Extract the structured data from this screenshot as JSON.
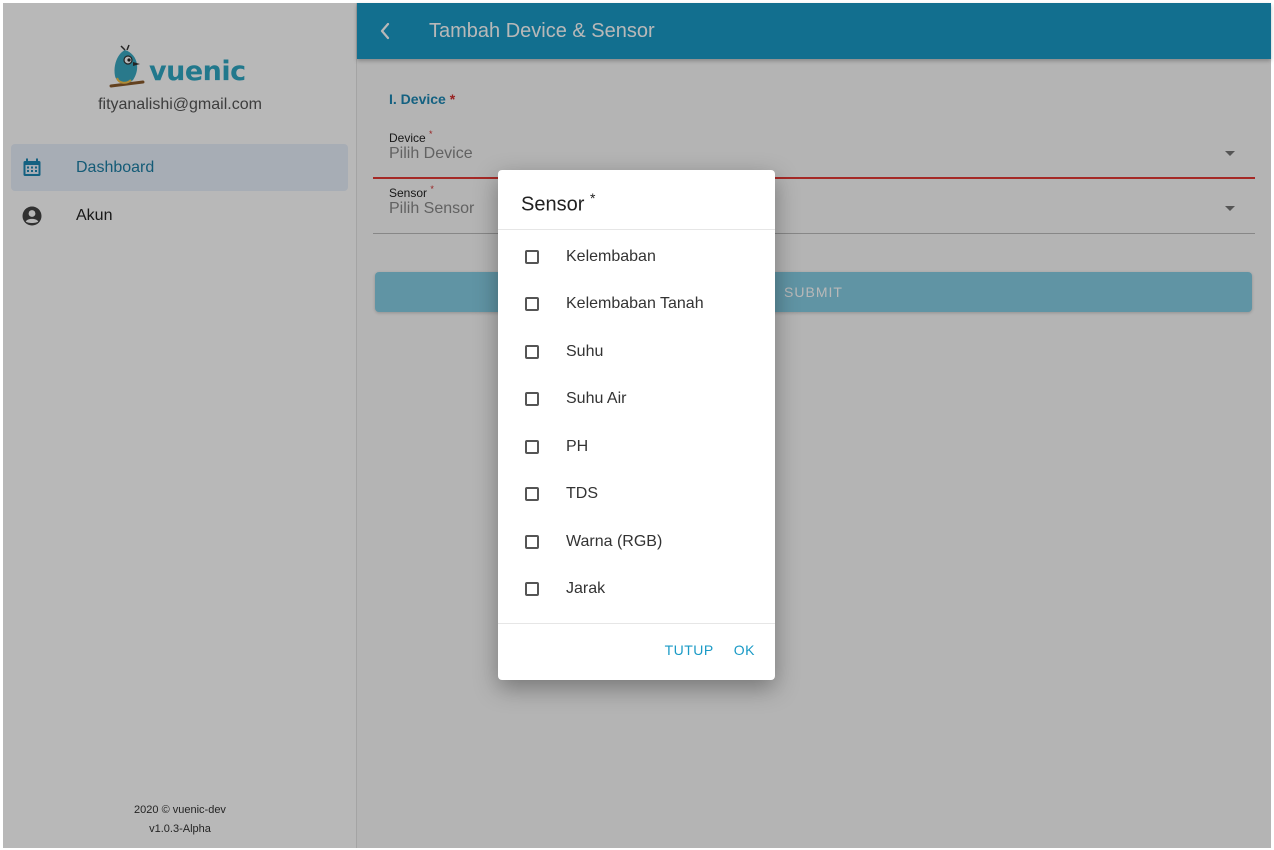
{
  "app": {
    "brand": "vuenic",
    "user_email": "fityanalishi@gmail.com"
  },
  "sidebar": {
    "items": [
      {
        "label": "Dashboard",
        "icon": "calendar-icon",
        "active": true
      },
      {
        "label": "Akun",
        "icon": "account-circle-icon",
        "active": false
      }
    ],
    "footer_line1": "2020 © vuenic-dev",
    "footer_line2": "v1.0.3-Alpha"
  },
  "header": {
    "title": "Tambah Device & Sensor",
    "back_icon": "chevron-left-icon"
  },
  "form": {
    "section_label": "I. Device",
    "required_mark": "*",
    "device": {
      "label": "Device",
      "placeholder": "Pilih Device"
    },
    "sensor": {
      "label": "Sensor",
      "placeholder": "Pilih Sensor"
    },
    "submit_label": "SUBMIT"
  },
  "dialog": {
    "title": "Sensor",
    "options": [
      {
        "label": "Kelembaban",
        "checked": false
      },
      {
        "label": "Kelembaban Tanah",
        "checked": false
      },
      {
        "label": "Suhu",
        "checked": false
      },
      {
        "label": "Suhu Air",
        "checked": false
      },
      {
        "label": "PH",
        "checked": false
      },
      {
        "label": "TDS",
        "checked": false
      },
      {
        "label": "Warna (RGB)",
        "checked": false
      },
      {
        "label": "Jarak",
        "checked": false
      }
    ],
    "cancel_label": "TUTUP",
    "ok_label": "OK"
  },
  "colors": {
    "primary": "#1a9ac6",
    "accent_text": "#1c7fa5",
    "error": "#e53935",
    "brand": "#2fa7c3"
  }
}
